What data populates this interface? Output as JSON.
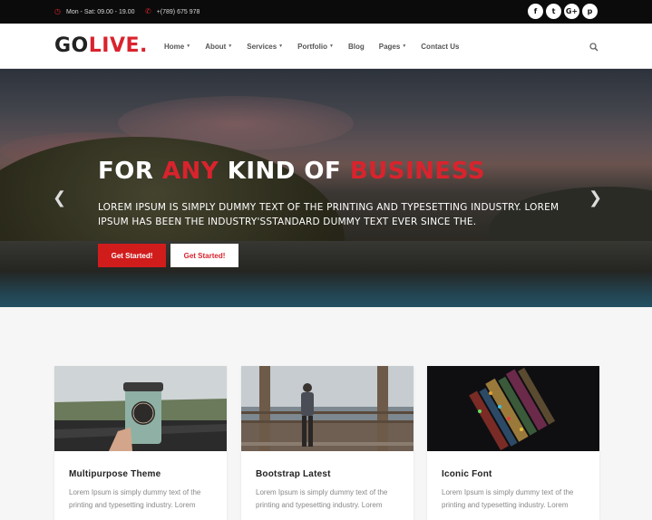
{
  "topbar": {
    "hours": "Mon - Sat: 09.00 - 19.00",
    "phone": "+(789) 675 978",
    "social": [
      {
        "icon": "facebook-icon",
        "glyph": "f"
      },
      {
        "icon": "twitter-icon",
        "glyph": "t"
      },
      {
        "icon": "google-plus-icon",
        "glyph": "G+"
      },
      {
        "icon": "pinterest-icon",
        "glyph": "p"
      }
    ]
  },
  "header": {
    "logo": {
      "go": "GO",
      "live": "LIVE",
      "dot": "."
    },
    "nav": [
      {
        "label": "Home",
        "dropdown": true
      },
      {
        "label": "About",
        "dropdown": true
      },
      {
        "label": "Services",
        "dropdown": true
      },
      {
        "label": "Portfolio",
        "dropdown": true
      },
      {
        "label": "Blog",
        "dropdown": false
      },
      {
        "label": "Pages",
        "dropdown": true
      },
      {
        "label": "Contact Us",
        "dropdown": false
      }
    ]
  },
  "hero": {
    "title_part1": "FOR ",
    "title_part2": "ANY",
    "title_part3": " KIND OF ",
    "title_part4": "BUSINESS",
    "subtitle": "LOREM IPSUM IS SIMPLY DUMMY TEXT OF THE PRINTING AND TYPESETTING INDUSTRY. LOREM IPSUM HAS BEEN THE INDUSTRY'SSTANDARD DUMMY TEXT EVER SINCE THE.",
    "primary_button": "Get Started!",
    "secondary_button": "Get Started!"
  },
  "cards": [
    {
      "title": "Multipurpose Theme",
      "text": "Lorem Ipsum is simply dummy text of the printing and typesetting industry. Lorem"
    },
    {
      "title": "Bootstrap Latest",
      "text": "Lorem Ipsum is simply dummy text of the printing and typesetting industry. Lorem"
    },
    {
      "title": "Iconic Font",
      "text": "Lorem Ipsum is simply dummy text of the printing and typesetting industry. Lorem"
    }
  ],
  "colors": {
    "accent": "#d9232d",
    "topbar": "#0b0b0b"
  }
}
